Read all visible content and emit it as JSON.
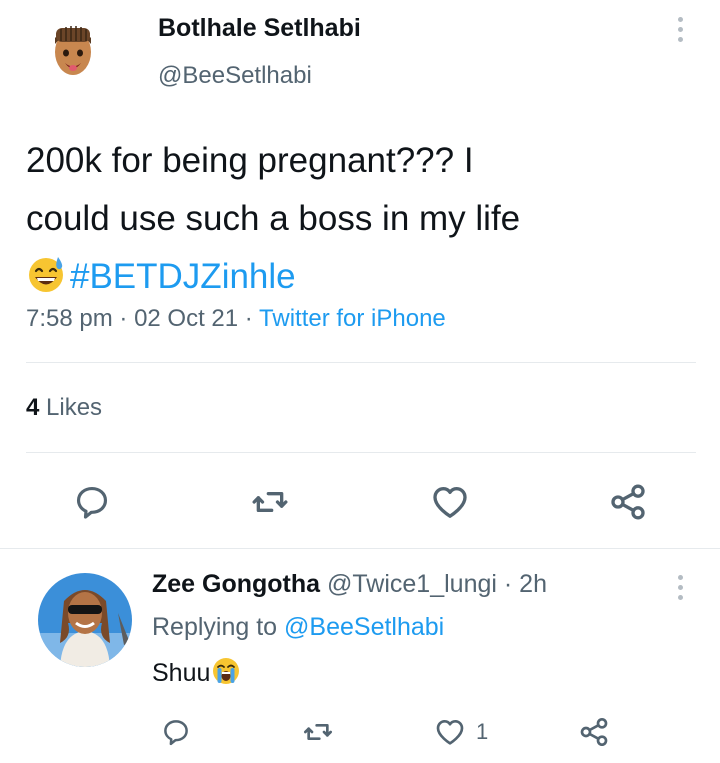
{
  "tweet": {
    "author_name": "Botlhale Setlhabi",
    "author_handle": "@BeeSetlhabi",
    "text_line1": "200k for being pregnant??? I",
    "text_line2": "could use such a boss in my life",
    "hashtag": "#BETDJZinhle",
    "time": "7:58 pm",
    "date": "02 Oct 21",
    "source": "Twitter for iPhone",
    "likes_count": "4",
    "likes_label": "Likes",
    "emoji": "sweat-smile-emoji",
    "colors": {
      "accent": "#1d9bf0",
      "text": "#0f1419",
      "muted": "#536471"
    }
  },
  "reply": {
    "author_name": "Zee Gongotha",
    "author_handle": "@Twice1_lungi",
    "time": "2h",
    "replying_prefix": "Replying to",
    "replying_to": "@BeeSetlhabi",
    "text": "Shuu",
    "emoji": "loudly-crying-emoji",
    "like_count": "1"
  },
  "separators": {
    "dot": "·"
  }
}
